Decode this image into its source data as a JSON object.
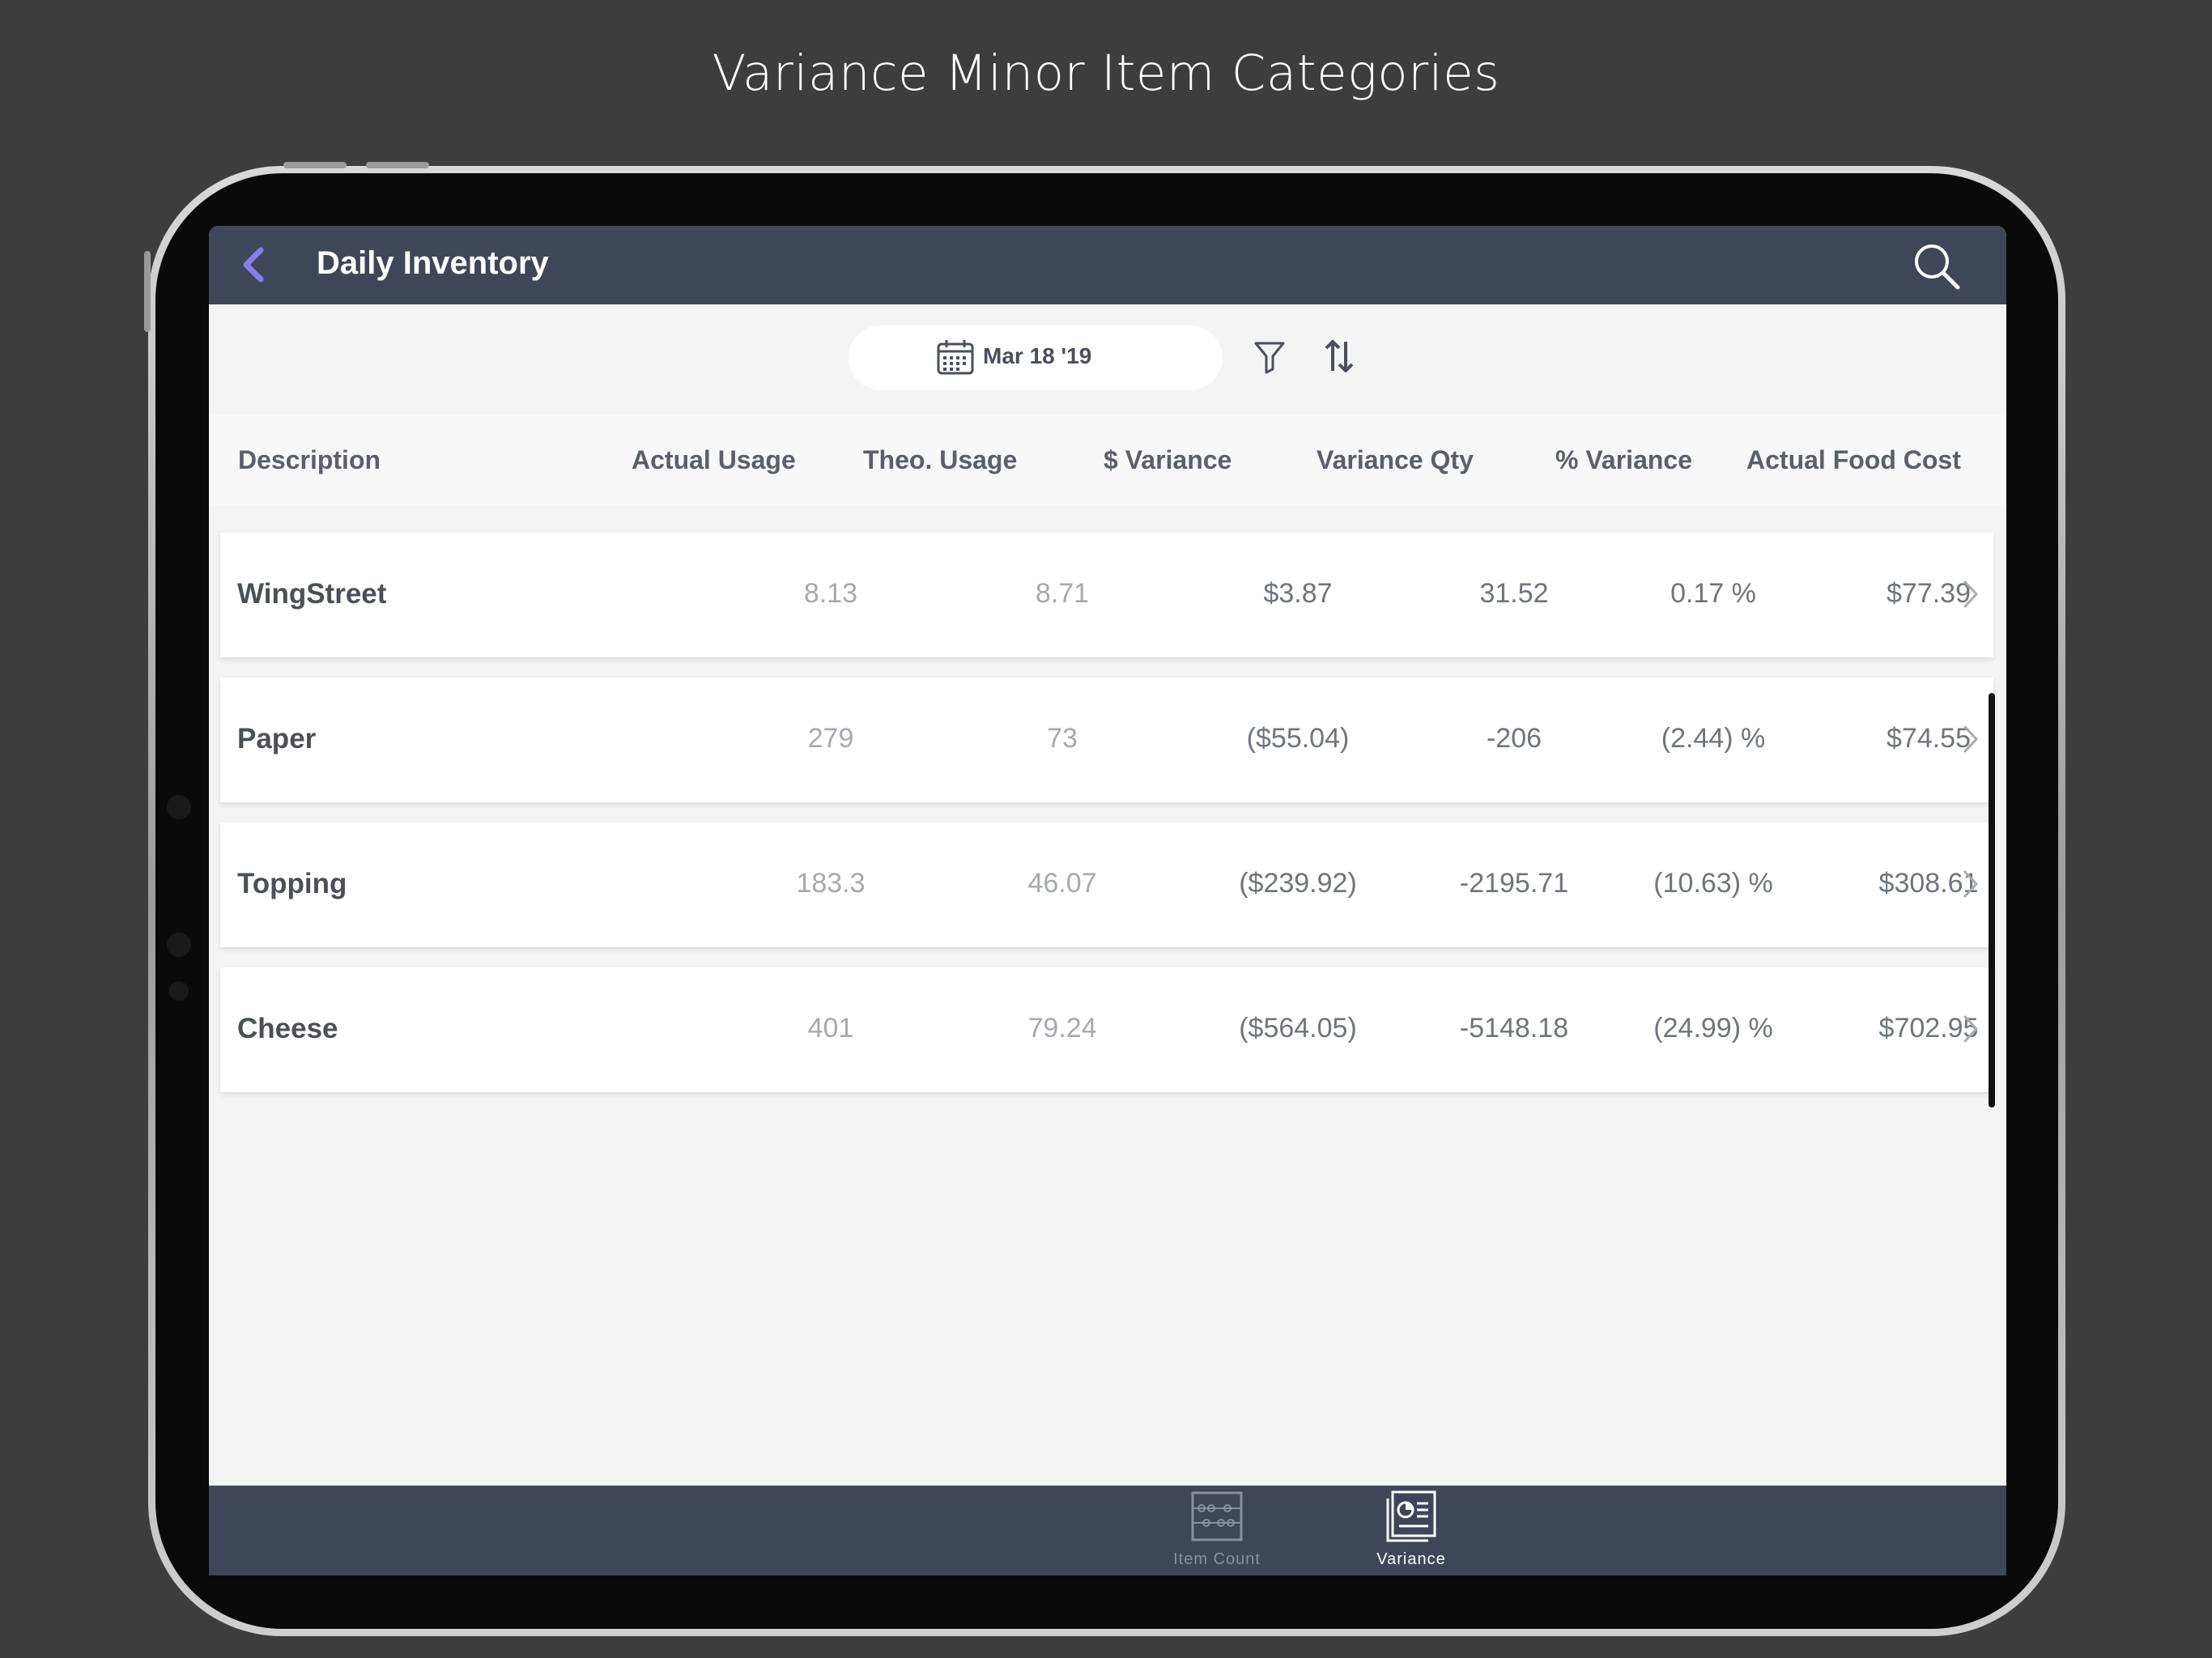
{
  "caption": "Variance Minor Item Categories",
  "navbar": {
    "title": "Daily Inventory"
  },
  "toolbar": {
    "date": "Mar 18 '19"
  },
  "table": {
    "headers": [
      "Description",
      "Actual Usage",
      "Theo. Usage",
      "$ Variance",
      "Variance Qty",
      "% Variance",
      "Actual Food Cost"
    ],
    "rows": [
      {
        "name": "WingStreet",
        "actual_usage": "8.13",
        "theo_usage": "8.71",
        "dollar_variance": "$3.87",
        "variance_qty": "31.52",
        "pct_variance": "0.17 %",
        "actual_food_cost": "$77.39"
      },
      {
        "name": "Paper",
        "actual_usage": "279",
        "theo_usage": "73",
        "dollar_variance": "($55.04)",
        "variance_qty": "-206",
        "pct_variance": "(2.44) %",
        "actual_food_cost": "$74.55"
      },
      {
        "name": "Topping",
        "actual_usage": "183.3",
        "theo_usage": "46.07",
        "dollar_variance": "($239.92)",
        "variance_qty": "-2195.71",
        "pct_variance": "(10.63) %",
        "actual_food_cost": "$308.61"
      },
      {
        "name": "Cheese",
        "actual_usage": "401",
        "theo_usage": "79.24",
        "dollar_variance": "($564.05)",
        "variance_qty": "-5148.18",
        "pct_variance": "(24.99) %",
        "actual_food_cost": "$702.95"
      }
    ]
  },
  "tabbar": {
    "tabs": [
      {
        "label": "Item Count",
        "icon": "abacus-icon",
        "active": false
      },
      {
        "label": "Variance",
        "icon": "variance-report-icon",
        "active": true
      }
    ]
  },
  "colors": {
    "navbar_bg": "#3f4657",
    "accent": "#8a7cf0",
    "screen_bg": "#f4f4f4",
    "page_bg": "#3d3d3d"
  }
}
